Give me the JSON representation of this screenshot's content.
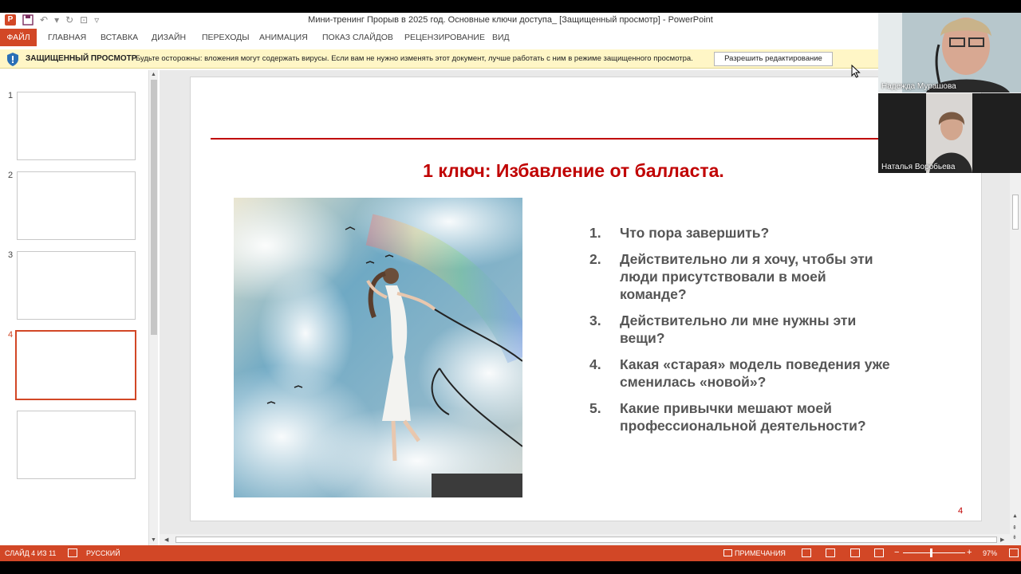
{
  "window": {
    "title": "Мини-тренинг Прорыв в 2025 год. Основные ключи доступа_ [Защищенный просмотр] - PowerPoint"
  },
  "ribbon": {
    "tabs": [
      "ФАЙЛ",
      "ГЛАВНАЯ",
      "ВСТАВКА",
      "ДИЗАЙН",
      "ПЕРЕХОДЫ",
      "АНИМАЦИЯ",
      "ПОКАЗ СЛАЙДОВ",
      "РЕЦЕНЗИРОВАНИЕ",
      "ВИД"
    ]
  },
  "protected_view": {
    "title": "ЗАЩИЩЕННЫЙ ПРОСМОТР",
    "message": "Будьте осторожны: вложения могут содержать вирусы. Если вам не нужно изменять этот документ, лучше работать с ним в режиме защищенного просмотра.",
    "button": "Разрешить редактирование"
  },
  "thumbnails": {
    "numbers": [
      "1",
      "2",
      "3",
      "4"
    ],
    "active_index": 3
  },
  "slide": {
    "title": "1 ключ: Избавление от балласта.",
    "questions": [
      {
        "num": "1.",
        "text": "Что пора завершить?"
      },
      {
        "num": "2.",
        "text": "Действительно ли я хочу, чтобы эти люди присутствовали в моей команде?"
      },
      {
        "num": "3.",
        "text": "Действительно ли мне нужны эти вещи?"
      },
      {
        "num": "4.",
        "text": "Какая «старая» модель поведения уже сменилась «новой»?"
      },
      {
        "num": "5.",
        "text": "Какие привычки мешают моей профессиональной деятельности?"
      }
    ],
    "page_number": "4"
  },
  "status": {
    "slide_info": "СЛАЙД 4 ИЗ 11",
    "language": "РУССКИЙ",
    "notes": "ПРИМЕЧАНИЯ",
    "zoom": "97%"
  },
  "participants": [
    {
      "name": "Надежда Мурашова"
    },
    {
      "name": "Наталья Воробьева"
    }
  ],
  "colors": {
    "accent": "#d24726",
    "title_red": "#c00000",
    "text_gray": "#555555"
  }
}
